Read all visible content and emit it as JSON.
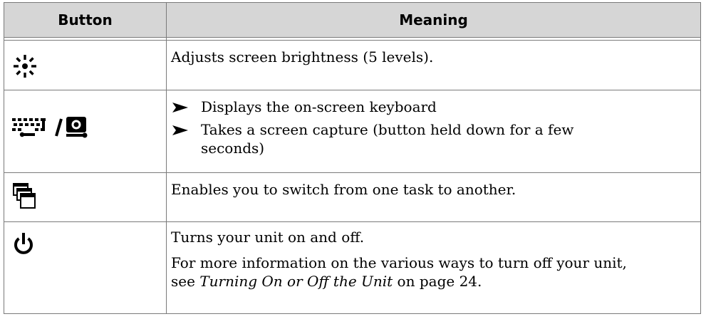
{
  "table": {
    "headers": {
      "button": "Button",
      "meaning": "Meaning"
    },
    "rows": [
      {
        "icon": "brightness-icon",
        "text": "Adjusts screen brightness (5 levels)."
      },
      {
        "icon": "keyboard-screen-capture-icon",
        "bullets": [
          "Displays the on-screen keyboard",
          "Takes a screen capture (button held down for a few",
          "seconds)"
        ]
      },
      {
        "icon": "task-switch-icon",
        "text": "Enables you to switch from one task to another."
      },
      {
        "icon": "power-icon",
        "text": "Turns your unit on and off.",
        "more_prefix": "For more information on the various ways to turn off your unit,",
        "more_see": "see ",
        "more_link": "Turning On or Off the Unit",
        "more_suffix": " on page 24."
      }
    ]
  }
}
